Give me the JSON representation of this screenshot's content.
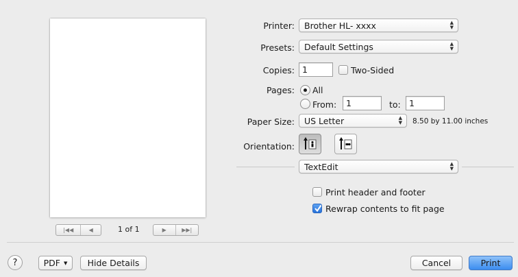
{
  "printer": {
    "label": "Printer:",
    "value": "Brother HL- xxxx"
  },
  "presets": {
    "label": "Presets:",
    "value": "Default Settings"
  },
  "copies": {
    "label": "Copies:",
    "value": "1",
    "two_sided_label": "Two-Sided",
    "two_sided_checked": false
  },
  "pages": {
    "label": "Pages:",
    "all_label": "All",
    "from_label": "From:",
    "from_value": "1",
    "to_label": "to:",
    "to_value": "1",
    "selected": "All"
  },
  "paper_size": {
    "label": "Paper Size:",
    "value": "US Letter",
    "dimensions": "8.50 by 11.00 inches"
  },
  "orientation": {
    "label": "Orientation:",
    "selected": "portrait"
  },
  "app_section": {
    "value": "TextEdit"
  },
  "options": {
    "print_header_footer": {
      "label": "Print header and footer",
      "checked": false
    },
    "rewrap": {
      "label": "Rewrap contents to fit page",
      "checked": true
    }
  },
  "preview": {
    "page_indicator": "1 of 1"
  },
  "footer": {
    "help_label": "?",
    "pdf_label": "PDF",
    "hide_details_label": "Hide Details",
    "cancel_label": "Cancel",
    "print_label": "Print"
  }
}
